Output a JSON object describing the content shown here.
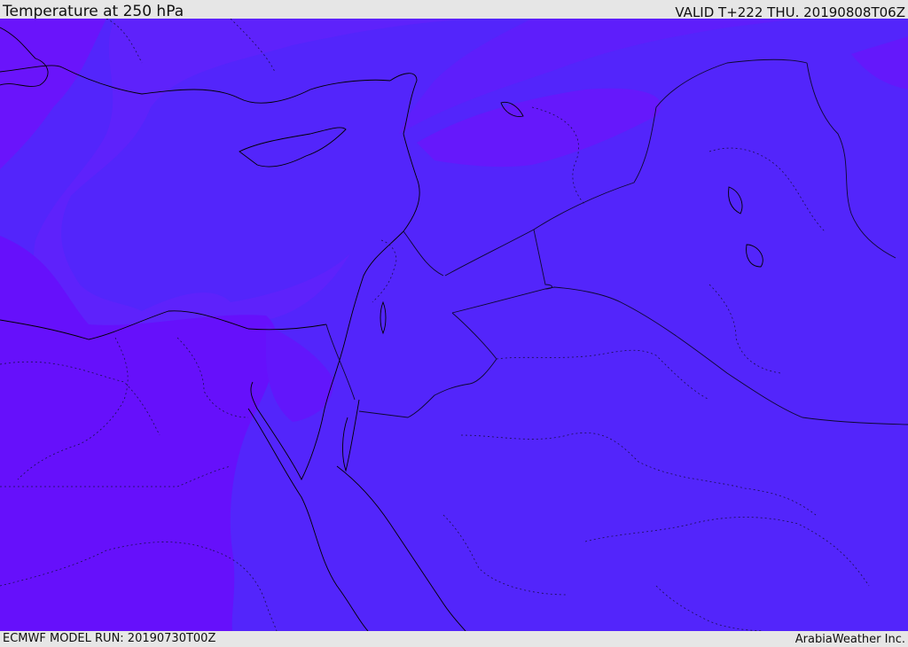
{
  "header": {
    "title": "Temperature at 250 hPa",
    "valid_time": "VALID T+222 THU. 20190808T06Z"
  },
  "footer": {
    "model_run": "ECMWF MODEL RUN: 20190730T00Z",
    "credit": "ArabiaWeather Inc."
  },
  "map": {
    "colors": {
      "cold_band": "#6a10fb",
      "warm_band": "#5325fb",
      "mid_band": "#5c28f5",
      "coastline": "#000000",
      "border": "#1a1040"
    }
  }
}
